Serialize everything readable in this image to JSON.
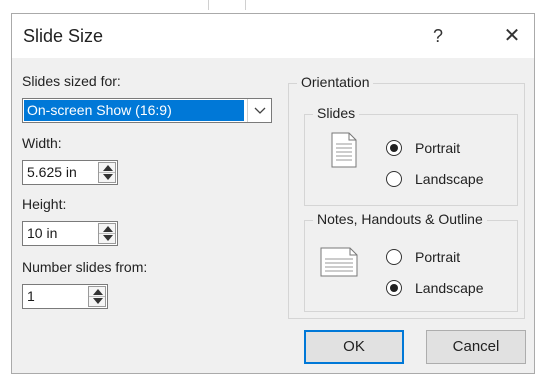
{
  "dialog": {
    "title": "Slide Size",
    "help_label": "?",
    "close_label": "✕"
  },
  "left": {
    "slides_sized_for_label": "Slides sized for:",
    "slides_sized_for_value": "On-screen Show (16:9)",
    "width_label": "Width:",
    "width_value": "5.625 in",
    "height_label": "Height:",
    "height_value": "10 in",
    "number_from_label": "Number slides from:",
    "number_from_value": "1"
  },
  "orientation": {
    "title": "Orientation",
    "slides_group": {
      "title": "Slides",
      "options": [
        "Portrait",
        "Landscape"
      ],
      "selected": "Portrait"
    },
    "notes_group": {
      "title": "Notes, Handouts & Outline",
      "options": [
        "Portrait",
        "Landscape"
      ],
      "selected": "Landscape"
    }
  },
  "buttons": {
    "ok": "OK",
    "cancel": "Cancel"
  }
}
